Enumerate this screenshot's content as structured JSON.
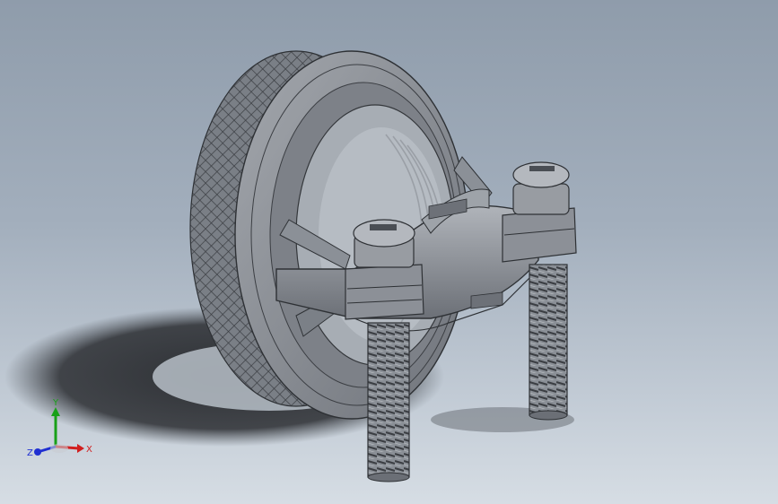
{
  "viewport": {
    "background_top": "#8f9cab",
    "background_bottom": "#d6dde4"
  },
  "model": {
    "icon": "pipe-ground-clamp-3d-model",
    "part_color": "#8c9097"
  },
  "triad": {
    "x_label": "X",
    "y_label": "Y",
    "z_label": "Z",
    "x_color": "#d11f1f",
    "y_color": "#18a018",
    "z_color": "#1f2fd1"
  }
}
